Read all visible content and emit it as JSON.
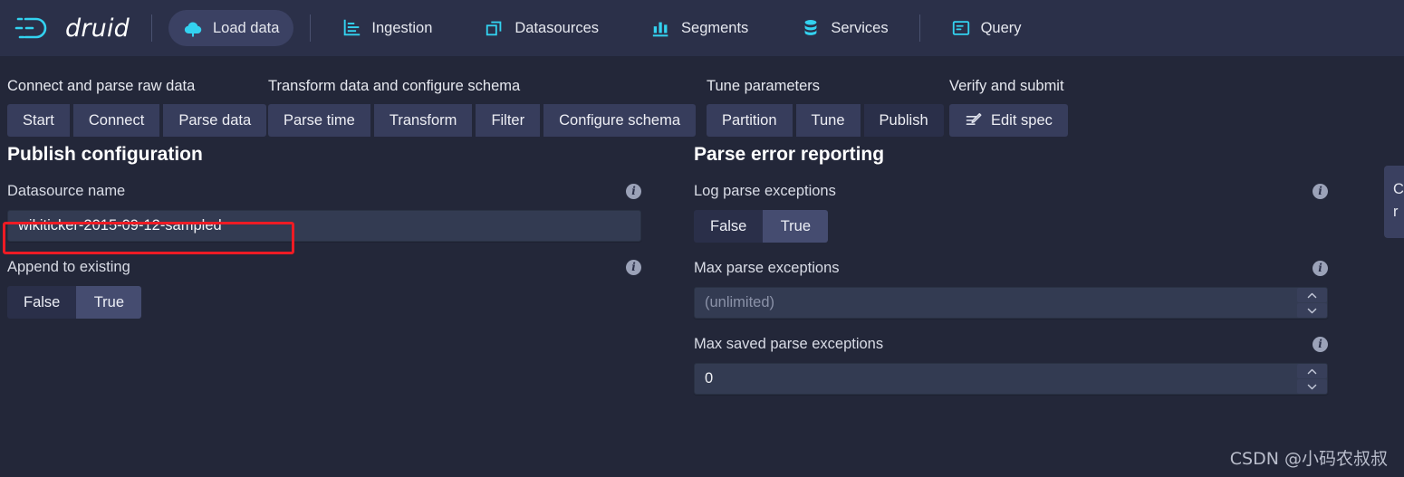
{
  "navbar": {
    "brand": "druid",
    "items": [
      {
        "label": "Load data",
        "icon": "cloud-upload-icon",
        "active": true
      },
      {
        "label": "Ingestion",
        "icon": "ingestion-icon",
        "active": false
      },
      {
        "label": "Datasources",
        "icon": "datasources-icon",
        "active": false
      },
      {
        "label": "Segments",
        "icon": "segments-icon",
        "active": false
      },
      {
        "label": "Services",
        "icon": "services-icon",
        "active": false
      },
      {
        "label": "Query",
        "icon": "query-icon",
        "active": false
      }
    ]
  },
  "steps": [
    {
      "title": "Connect and parse raw data",
      "buttons": [
        {
          "label": "Start",
          "active": false
        },
        {
          "label": "Connect",
          "active": false
        },
        {
          "label": "Parse data",
          "active": false
        }
      ]
    },
    {
      "title": "Transform data and configure schema",
      "buttons": [
        {
          "label": "Parse time",
          "active": false
        },
        {
          "label": "Transform",
          "active": false
        },
        {
          "label": "Filter",
          "active": false
        },
        {
          "label": "Configure schema",
          "active": false
        }
      ]
    },
    {
      "title": "Tune parameters",
      "buttons": [
        {
          "label": "Partition",
          "active": false
        },
        {
          "label": "Tune",
          "active": false
        },
        {
          "label": "Publish",
          "active": true
        }
      ]
    },
    {
      "title": "Verify and submit",
      "buttons": [
        {
          "label": "Edit spec",
          "active": false,
          "icon": "edit-spec-icon"
        }
      ]
    }
  ],
  "publish_configuration": {
    "title": "Publish configuration",
    "datasource_name": {
      "label": "Datasource name",
      "value": "wikiticker-2015-09-12-sampled",
      "placeholder": ""
    },
    "append_to_existing": {
      "label": "Append to existing",
      "options": [
        "False",
        "True"
      ],
      "selected": "True"
    }
  },
  "parse_error_reporting": {
    "title": "Parse error reporting",
    "log_parse_exceptions": {
      "label": "Log parse exceptions",
      "options": [
        "False",
        "True"
      ],
      "selected": "True"
    },
    "max_parse_exceptions": {
      "label": "Max parse exceptions",
      "value": "",
      "placeholder": "(unlimited)"
    },
    "max_saved_parse_exceptions": {
      "label": "Max saved parse exceptions",
      "value": "0",
      "placeholder": ""
    }
  },
  "help_card": {
    "line1": "C",
    "line2": "r"
  },
  "watermark": "CSDN @小码农叔叔",
  "colors": {
    "accent": "#33d2f0",
    "annotation": "#ee1b24",
    "page_background": "#232739",
    "navbar_background": "#2b3049",
    "input_background": "#333b52"
  }
}
